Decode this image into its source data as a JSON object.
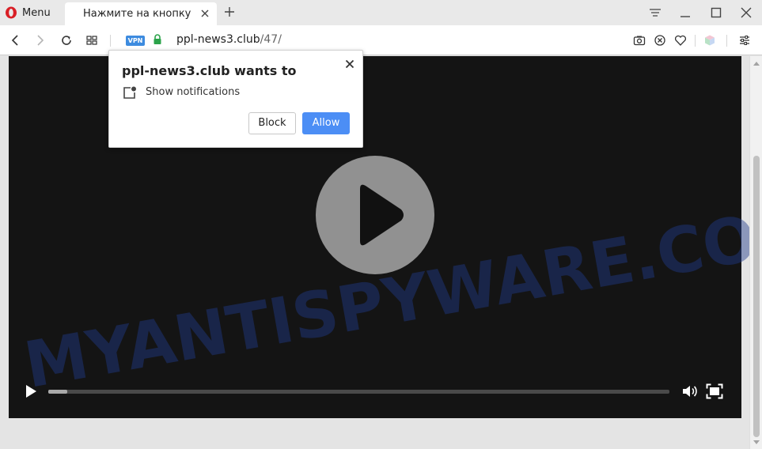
{
  "browser": {
    "menu_label": "Menu",
    "tab_title": "Нажмите на кнопку «Разрешить»",
    "vpn_label": "VPN",
    "url_host": "ppl-news3.club",
    "url_path": "/47/"
  },
  "popup": {
    "title": "ppl-news3.club wants to",
    "permission_text": "Show notifications",
    "block_label": "Block",
    "allow_label": "Allow"
  },
  "video": {
    "progress_fraction": 0.03
  },
  "watermark": {
    "text": "MYANTISPYWARE.COM"
  },
  "colors": {
    "opera_red": "#d91f26",
    "vpn_blue": "#3d8bdf",
    "lock_green": "#2ba34a",
    "allow_blue": "#4c8ef5",
    "video_bg": "#141414",
    "watermark": "#1f3a8a"
  },
  "icons": {
    "back": "back-arrow-icon",
    "forward": "forward-arrow-icon",
    "reload": "reload-icon",
    "tabs_grid": "speed-dial-icon",
    "lock": "lock-icon",
    "camera": "snapshot-icon",
    "adblock": "ad-block-icon",
    "heart": "heart-icon",
    "cube": "extension-cube-icon",
    "easy_setup": "easy-setup-icon"
  }
}
